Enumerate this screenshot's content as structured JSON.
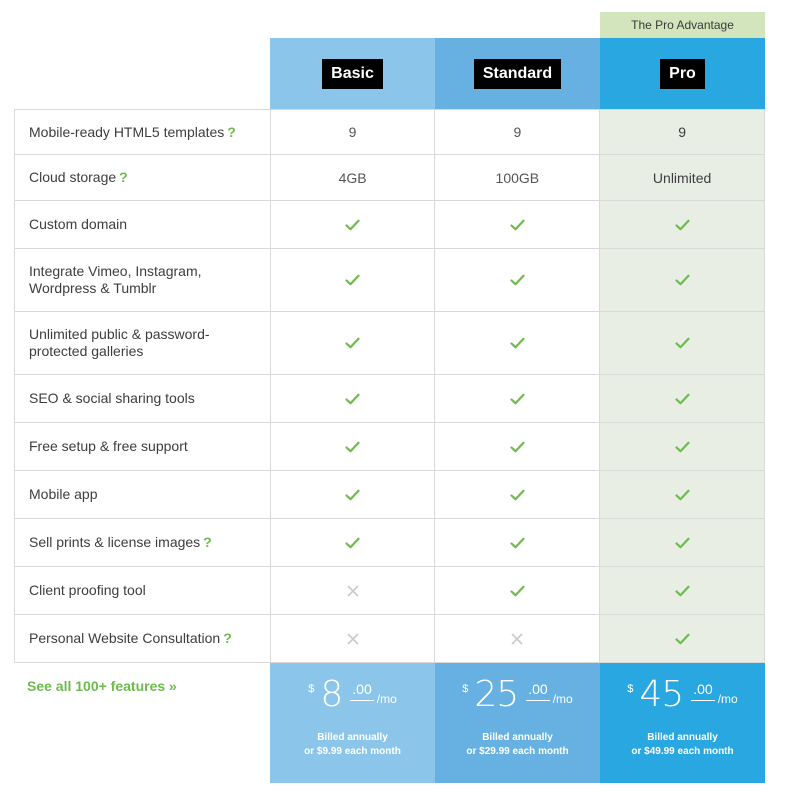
{
  "highlight_badge": "The Pro Advantage",
  "plans": [
    {
      "name": "Basic",
      "currency": "$",
      "price_whole": "8",
      "price_cents": ".00",
      "period": "/mo",
      "billing_line1": "Billed annually",
      "billing_line2": "or $9.99 each month",
      "color": "#8cc5ea"
    },
    {
      "name": "Standard",
      "currency": "$",
      "price_whole": "25",
      "price_cents": ".00",
      "period": "/mo",
      "billing_line1": "Billed annually",
      "billing_line2": "or $29.99 each month",
      "color": "#67b1e2"
    },
    {
      "name": "Pro",
      "currency": "$",
      "price_whole": "45",
      "price_cents": ".00",
      "period": "/mo",
      "billing_line1": "Billed annually",
      "billing_line2": "or $49.99 each month",
      "color": "#29a7e1"
    }
  ],
  "features": [
    {
      "label": "Mobile-ready HTML5 templates",
      "help": "?",
      "values": [
        "9",
        "9",
        "9"
      ]
    },
    {
      "label": "Cloud storage",
      "help": "?",
      "values": [
        "4GB",
        "100GB",
        "Unlimited"
      ]
    },
    {
      "label": "Custom domain",
      "help": null,
      "values": [
        "check",
        "check",
        "check"
      ]
    },
    {
      "label": "Integrate Vimeo, Instagram, Wordpress & Tumblr",
      "help": null,
      "values": [
        "check",
        "check",
        "check"
      ]
    },
    {
      "label": "Unlimited public & password-protected galleries",
      "help": null,
      "values": [
        "check",
        "check",
        "check"
      ]
    },
    {
      "label": "SEO & social sharing tools",
      "help": null,
      "values": [
        "check",
        "check",
        "check"
      ]
    },
    {
      "label": "Free setup & free support",
      "help": null,
      "values": [
        "check",
        "check",
        "check"
      ]
    },
    {
      "label": "Mobile app",
      "help": null,
      "values": [
        "check",
        "check",
        "check"
      ]
    },
    {
      "label": "Sell prints & license images",
      "help": "?",
      "values": [
        "check",
        "check",
        "check"
      ]
    },
    {
      "label": "Client proofing tool",
      "help": null,
      "values": [
        "cross",
        "check",
        "check"
      ]
    },
    {
      "label": "Personal Website Consultation",
      "help": "?",
      "values": [
        "cross",
        "cross",
        "check"
      ]
    }
  ],
  "see_all_link": "See all 100+ features »",
  "colors": {
    "check": "#6dbb4c",
    "cross": "#cccccc",
    "pro_column_bg": "#e9eee5",
    "badge_bg": "#d3e5bd"
  }
}
